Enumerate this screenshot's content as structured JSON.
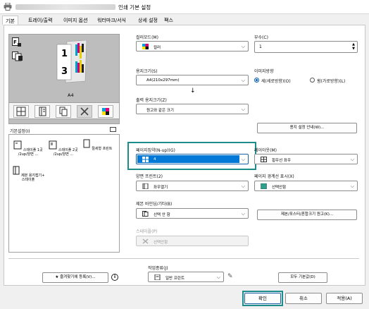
{
  "window": {
    "title": "인쇄 기본 설정"
  },
  "tabs": [
    {
      "label": "기본"
    },
    {
      "label": "트레이/출력"
    },
    {
      "label": "이미지 옵션"
    },
    {
      "label": "워터마크/서식"
    },
    {
      "label": "상세 설정"
    },
    {
      "label": "팩스"
    }
  ],
  "preview": {
    "paper_label": "A4",
    "page_numbers": [
      "1",
      "3"
    ]
  },
  "favorites": {
    "label": "기본설정(I)",
    "items": [
      {
        "label": "스테이플 1곳 /2up/양면 ..."
      },
      {
        "label": "스테이플 2곳 /2up/양면 ..."
      },
      {
        "label": "절세형 프린트"
      },
      {
        "label": "제본 용지접기+ 스테이플"
      }
    ]
  },
  "settings": {
    "color_mode": {
      "label": "컬러모드(M)",
      "value": "컬러"
    },
    "copies": {
      "label": "부수(C)",
      "value": "1"
    },
    "paper_size": {
      "label": "용지크기(S)",
      "value": "A4(210x297mm)"
    },
    "orientation": {
      "label": "이미지방향",
      "options": [
        "세(세로방향)(O)",
        "횡(가로방향)(L)"
      ],
      "selected": 0
    },
    "output_paper_size": {
      "label": "출력 용지크기(Z)",
      "value": "원고와 같은 크기"
    },
    "paper_settings_button": "용지 설정 안내(W)...",
    "n_up": {
      "label": "페이지집약(N-up)(G)",
      "value": "4"
    },
    "layout_order": {
      "label": "레이아웃(M)",
      "value": "횡우선 좌우"
    },
    "duplex": {
      "label": "양면 프린트(2)",
      "value": "좌우열기"
    },
    "page_border": {
      "label": "페이지 경계선 표시(X)",
      "value": "선택안함"
    },
    "binding": {
      "label": "제본 바인딩/기타(B)",
      "value": "선택 안 함"
    },
    "binding_button": "제본/포스터/혼합크기 원고(K)...",
    "staple": {
      "label": "스테이플(P)",
      "value": "선택안함"
    }
  },
  "bottom": {
    "add_favorite_button": "즐겨찾기에 등록(V)...",
    "info_icon": "info-icon",
    "job_type_label": "작업종류(J)",
    "job_type_value": "일반 프린트",
    "restore_button": "모두 기본값(D)"
  },
  "dialog": {
    "ok": "확인",
    "cancel": "취소",
    "apply": "적용(A)"
  },
  "colors": {
    "accent": "#0078d7",
    "highlight": "#1c8c8c"
  }
}
